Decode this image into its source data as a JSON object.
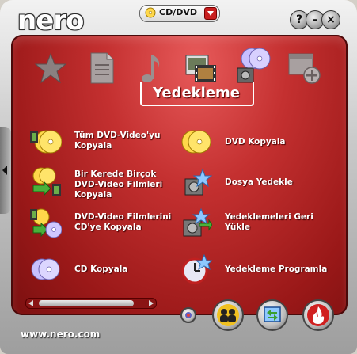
{
  "app": {
    "logo": "nero",
    "site": "www.nero.com"
  },
  "mode_selector": {
    "label": "CD/DVD"
  },
  "title_buttons": {
    "help": "?",
    "minimize": "–",
    "close": "×"
  },
  "categories": [
    {
      "name": "favorites",
      "icon": "star-icon"
    },
    {
      "name": "data",
      "icon": "document-icon"
    },
    {
      "name": "audio",
      "icon": "music-note-icon"
    },
    {
      "name": "photo-video",
      "icon": "film-photo-icon"
    },
    {
      "name": "backup",
      "icon": "backup-discs-icon"
    },
    {
      "name": "extras",
      "icon": "add-window-icon"
    }
  ],
  "selected_category": "Yedekleme",
  "tasks": [
    {
      "label": "Tüm DVD-Video'yu Kopyala",
      "icon": "dvd-video-copy-icon"
    },
    {
      "label": "DVD Kopyala",
      "icon": "dvd-copy-icon"
    },
    {
      "label": "Bir Kerede Birçok DVD-Video Filmleri Kopyala",
      "icon": "multi-dvd-copy-icon"
    },
    {
      "label": "Dosya Yedekle",
      "icon": "file-backup-icon"
    },
    {
      "label": "DVD-Video Filmlerini CD'ye Kopyala",
      "icon": "dvd-to-cd-icon"
    },
    {
      "label": "Yedeklemeleri Geri Yükle",
      "icon": "restore-backup-icon"
    },
    {
      "label": "CD Kopyala",
      "icon": "cd-copy-icon"
    },
    {
      "label": "Yedekleme Programla",
      "icon": "schedule-backup-icon"
    }
  ],
  "colors": {
    "panel": "#c43030",
    "accent": "#c81e1e",
    "text": "#ffffff"
  }
}
